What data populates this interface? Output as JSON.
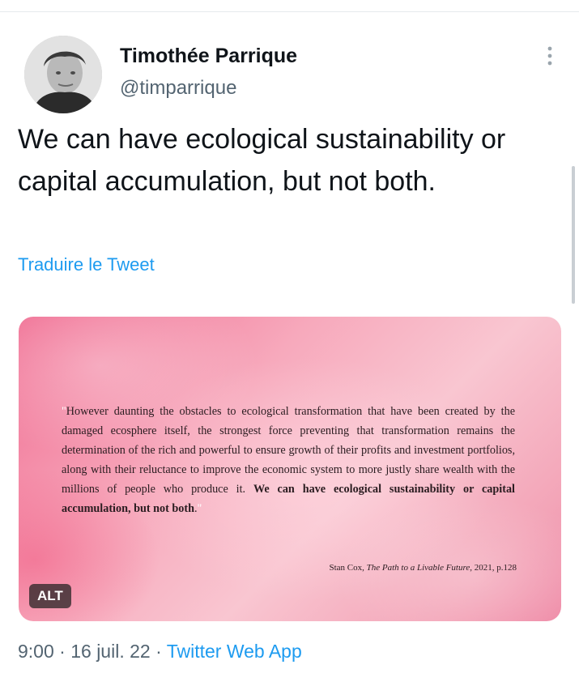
{
  "author": {
    "display_name": "Timothée Parrique",
    "handle": "@timparrique"
  },
  "tweet": {
    "text": "We can have ecological sustainability or capital accumulation, but not both.",
    "translate_label": "Traduire le Tweet"
  },
  "media": {
    "quote_open": "\"",
    "quote_body": "However daunting the obstacles to ecological transformation that have been created by the damaged ecosphere itself, the strongest force preventing that transformation remains the determination of the rich and powerful to ensure growth of their profits and investment portfolios, along with their reluctance to improve the economic system to more justly share wealth with the millions of people who produce it. ",
    "quote_bold": "We can have ecological sustainability or capital accumulation, but not both",
    "quote_end": ".",
    "quote_close": "\"",
    "citation_author": "Stan Cox, ",
    "citation_title": "The Path to a Livable Future",
    "citation_rest": ", 2021, p.128",
    "alt_label": "ALT"
  },
  "meta": {
    "time": "9:00",
    "separator_1": " · ",
    "date": "16 juil. 22",
    "separator_2": " · ",
    "source": "Twitter Web App"
  },
  "icons": {
    "more": "more-vertical-icon"
  },
  "colors": {
    "link": "#1d9bf0",
    "secondary_text": "#536471",
    "primary_text": "#0f1419",
    "card_pink": "#f06d92"
  }
}
